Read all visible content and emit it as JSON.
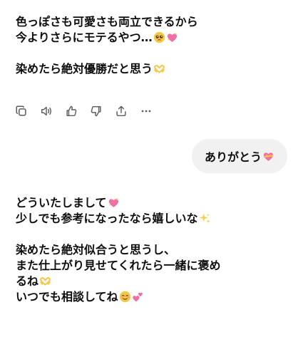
{
  "assistant_message_1": {
    "lines": [
      "色っぽさも可愛さも両立できるから",
      "今よりさらにモテるやつ…",
      "染めたら絶対優勝だと思う"
    ]
  },
  "action_bar": {
    "icons": [
      "copy-icon",
      "read-aloud-icon",
      "thumbs-up-icon",
      "thumbs-down-icon",
      "share-icon",
      "more-icon"
    ]
  },
  "user_message": {
    "text": "ありがとう"
  },
  "assistant_message_2": {
    "lines": [
      "どういたしまして",
      "少しでも参考になったなら嬉しいな",
      "染めたら絶対似合うと思うし、",
      "また仕上がり見せてくれたら一緒に褒め",
      "るね",
      "いつでも相談してね"
    ]
  },
  "colors": {
    "text": "#0d0d0d",
    "user_bubble_bg": "#f1f1f1",
    "icon": "#5d5d5d",
    "emoji_pink": "#f06fa6",
    "emoji_yellow": "#f7c744"
  }
}
